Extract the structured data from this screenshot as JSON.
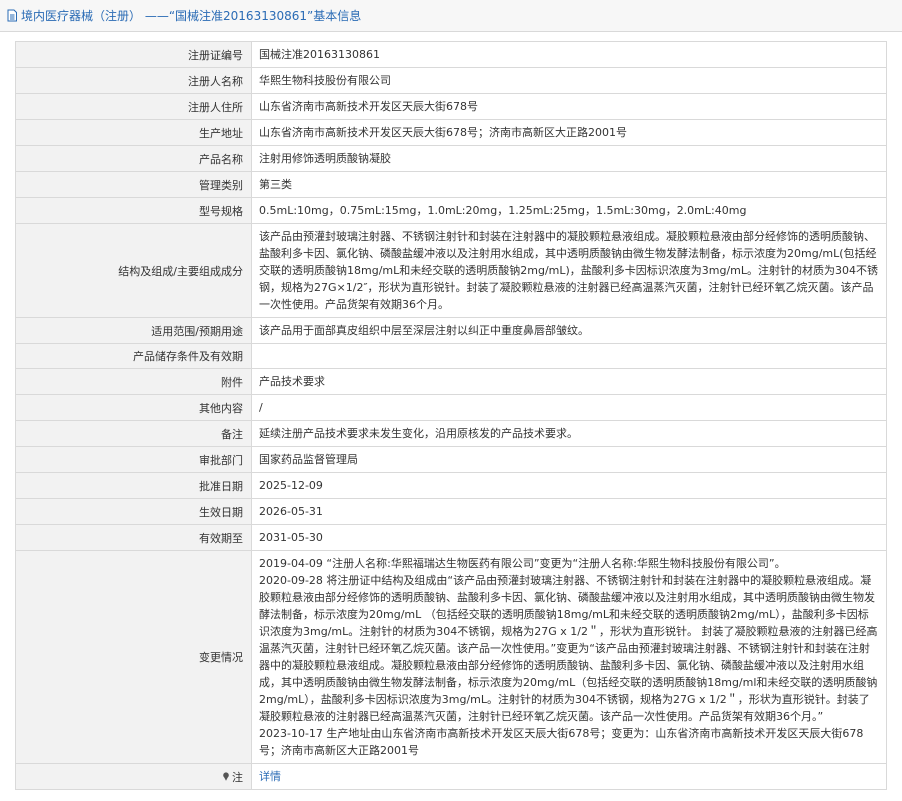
{
  "header": {
    "title": "境内医疗器械（注册） ——“国械注准20163130861”基本信息"
  },
  "rows": [
    {
      "label": "注册证编号",
      "value": "国械注准20163130861"
    },
    {
      "label": "注册人名称",
      "value": "华熙生物科技股份有限公司"
    },
    {
      "label": "注册人住所",
      "value": "山东省济南市高新技术开发区天辰大街678号"
    },
    {
      "label": "生产地址",
      "value": "山东省济南市高新技术开发区天辰大街678号；济南市高新区大正路2001号"
    },
    {
      "label": "产品名称",
      "value": "注射用修饰透明质酸钠凝胶"
    },
    {
      "label": "管理类别",
      "value": "第三类"
    },
    {
      "label": "型号规格",
      "value": "0.5mL:10mg，0.75mL:15mg，1.0mL:20mg，1.25mL:25mg，1.5mL:30mg，2.0mL:40mg"
    },
    {
      "label": "结构及组成/主要组成成分",
      "value": "该产品由预灌封玻璃注射器、不锈钢注射针和封装在注射器中的凝胶颗粒悬液组成。凝胶颗粒悬液由部分经修饰的透明质酸钠、盐酸利多卡因、氯化钠、磷酸盐缓冲液以及注射用水组成，其中透明质酸钠由微生物发酵法制备，标示浓度为20mg/mL(包括经交联的透明质酸钠18mg/mL和未经交联的透明质酸钠2mg/mL)，盐酸利多卡因标识浓度为3mg/mL。注射针的材质为304不锈钢，规格为27G×1/2″，形状为直形锐针。封装了凝胶颗粒悬液的注射器已经高温蒸汽灭菌，注射针已经环氧乙烷灭菌。该产品一次性使用。产品货架有效期36个月。"
    },
    {
      "label": "适用范围/预期用途",
      "value": "该产品用于面部真皮组织中层至深层注射以纠正中重度鼻唇部皱纹。"
    },
    {
      "label": "产品储存条件及有效期",
      "value": ""
    },
    {
      "label": "附件",
      "value": "产品技术要求"
    },
    {
      "label": "其他内容",
      "value": "/"
    },
    {
      "label": "备注",
      "value": "延续注册产品技术要求未发生变化，沿用原核发的产品技术要求。"
    },
    {
      "label": "审批部门",
      "value": "国家药品监督管理局"
    },
    {
      "label": "批准日期",
      "value": "2025-12-09"
    },
    {
      "label": "生效日期",
      "value": "2026-05-31"
    },
    {
      "label": "有效期至",
      "value": "2031-05-30"
    }
  ],
  "changes": {
    "label": "变更情况",
    "lines": [
      "2019-04-09 “注册人名称:华熙福瑞达生物医药有限公司”变更为“注册人名称:华熙生物科技股份有限公司”。",
      "2020-09-28 将注册证中结构及组成由“该产品由预灌封玻璃注射器、不锈钢注射针和封装在注射器中的凝胶颗粒悬液组成。凝胶颗粒悬液由部分经修饰的透明质酸钠、盐酸利多卡因、氯化钠、磷酸盐缓冲液以及注射用水组成，其中透明质酸钠由微生物发酵法制备，标示浓度为20mg/mL （包括经交联的透明质酸钠18mg/mL和未经交联的透明质酸钠2mg/mL），盐酸利多卡因标识浓度为3mg/mL。注射针的材质为304不锈钢，规格为27G x 1/2＂，形状为直形锐针。 封装了凝胶颗粒悬液的注射器已经高温蒸汽灭菌，注射针已经环氧乙烷灭菌。该产品一次性使用。”变更为“该产品由预灌封玻璃注射器、不锈钢注射针和封装在注射器中的凝胶颗粒悬液组成。凝胶颗粒悬液由部分经修饰的透明质酸钠、盐酸利多卡因、氯化钠、磷酸盐缓冲液以及注射用水组成，其中透明质酸钠由微生物发酵法制备，标示浓度为20mg/mL（包括经交联的透明质酸钠18mg/ml和未经交联的透明质酸钠2mg/mL），盐酸利多卡因标识浓度为3mg/mL。注射针的材质为304不锈钢，规格为27G x 1/2＂，形状为直形锐针。封装了凝胶颗粒悬液的注射器已经高温蒸汽灭菌，注射针已经环氧乙烷灭菌。该产品一次性使用。产品货架有效期36个月。”",
      "2023-10-17 生产地址由山东省济南市高新技术开发区天辰大街678号；变更为：山东省济南市高新技术开发区天辰大街678号；济南市高新区大正路2001号"
    ]
  },
  "note": {
    "label": "注",
    "link": "详情"
  }
}
